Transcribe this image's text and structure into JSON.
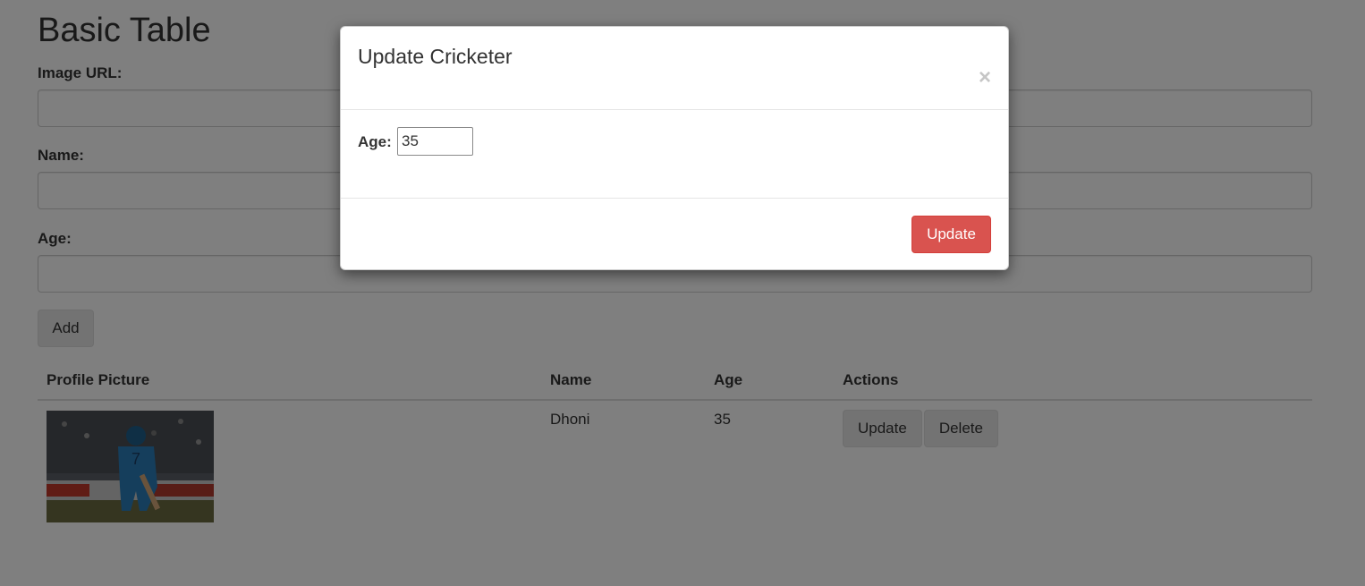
{
  "page": {
    "title": "Basic Table"
  },
  "form": {
    "image_url_label": "Image URL:",
    "image_url_value": "",
    "name_label": "Name:",
    "name_value": "",
    "age_label": "Age:",
    "age_value": "",
    "add_label": "Add"
  },
  "table": {
    "headers": [
      "Profile Picture",
      "Name",
      "Age",
      "Actions"
    ],
    "rows": [
      {
        "name": "Dhoni",
        "age": "35",
        "update_label": "Update",
        "delete_label": "Delete"
      }
    ]
  },
  "modal": {
    "title": "Update Cricketer",
    "close_glyph": "×",
    "age_label": "Age:",
    "age_value": "35",
    "update_label": "Update",
    "accent_color": "#d9534f"
  }
}
